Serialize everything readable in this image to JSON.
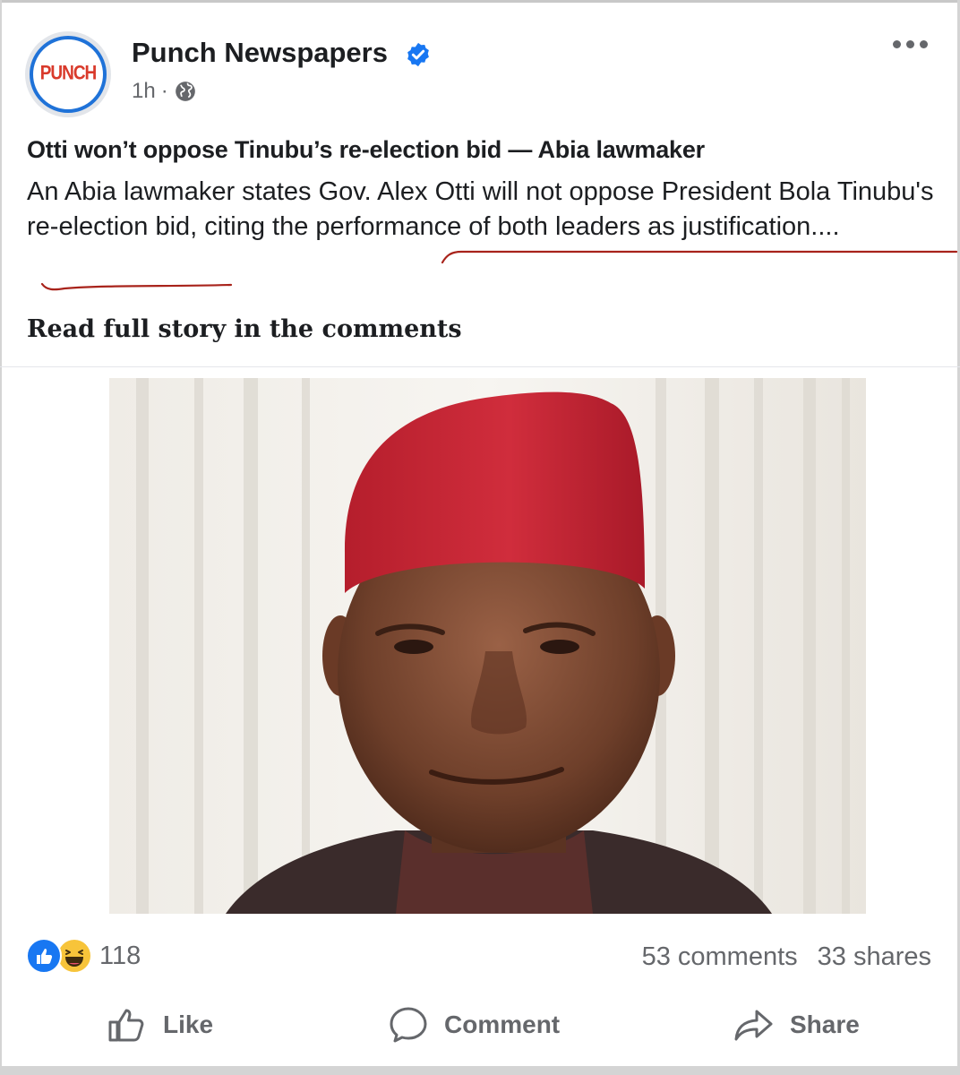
{
  "post": {
    "page_name": "Punch Newspapers",
    "logo_text": "PUNCH",
    "timestamp": "1h",
    "separator": "·",
    "headline": "Otti won’t oppose Tinubu’s re-election bid — Abia lawmaker",
    "body": " An Abia lawmaker states Gov. Alex Otti will not oppose President Bola Tinubu's re-election bid, citing the performance of both leaders as justification....",
    "read_more": "Read full story in the comments"
  },
  "engagement": {
    "reaction_count": "118",
    "comments": "53 comments",
    "shares": "33 shares"
  },
  "actions": {
    "like_label": "Like",
    "comment_label": "Comment",
    "share_label": "Share"
  },
  "icons": {
    "verified": "verified-badge-icon",
    "audience": "globe-icon",
    "more": "more-options-icon",
    "reaction_like": "like-reaction-icon",
    "reaction_haha": "haha-reaction-icon"
  },
  "colors": {
    "verified_blue": "#1877f2",
    "logo_red": "#d93a2b",
    "annotation_red": "#a8231b",
    "muted_text": "#65676b"
  }
}
